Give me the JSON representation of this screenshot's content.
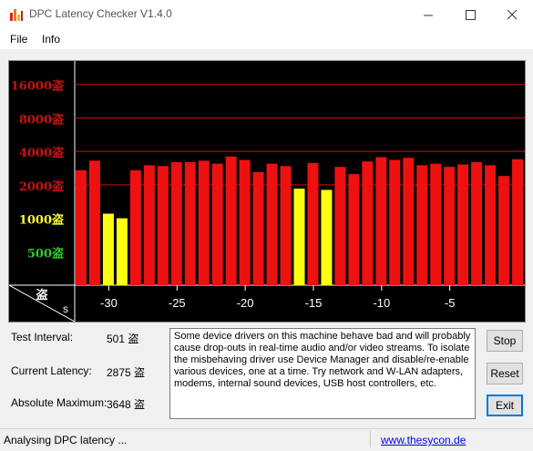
{
  "window": {
    "title": "DPC Latency Checker V1.4.0"
  },
  "menu": {
    "items": [
      "File",
      "Info"
    ]
  },
  "chart_data": {
    "type": "bar",
    "y_ticks": [
      {
        "label": "16000盗",
        "value": 16000,
        "color": "#cc1111"
      },
      {
        "label": "8000盗",
        "value": 8000,
        "color": "#cc1111"
      },
      {
        "label": "4000盗",
        "value": 4000,
        "color": "#cc1111"
      },
      {
        "label": "2000盗",
        "value": 2000,
        "color": "#cc1111"
      },
      {
        "label": "1000盗",
        "value": 1000,
        "color": "#ffff33"
      },
      {
        "label": "500盗",
        "value": 500,
        "color": "#33cc33"
      }
    ],
    "x_ticks": [
      -30,
      -25,
      -20,
      -15,
      -10,
      -5
    ],
    "x_tick_labels": [
      "-30",
      "-25",
      "-20",
      "-15",
      "-10",
      "-5"
    ],
    "corner_top": "盗",
    "corner_bottom": "s",
    "x_range": [
      -32,
      -1
    ],
    "bars": [
      {
        "x": -32,
        "value": 2700,
        "color": "red"
      },
      {
        "x": -31,
        "value": 3300,
        "color": "red"
      },
      {
        "x": -30,
        "value": 1100,
        "color": "yellow"
      },
      {
        "x": -29,
        "value": 1000,
        "color": "yellow"
      },
      {
        "x": -28,
        "value": 2700,
        "color": "red"
      },
      {
        "x": -27,
        "value": 3000,
        "color": "red"
      },
      {
        "x": -26,
        "value": 2950,
        "color": "red"
      },
      {
        "x": -25,
        "value": 3200,
        "color": "red"
      },
      {
        "x": -24,
        "value": 3200,
        "color": "red"
      },
      {
        "x": -23,
        "value": 3300,
        "color": "red"
      },
      {
        "x": -22,
        "value": 3100,
        "color": "red"
      },
      {
        "x": -21,
        "value": 3600,
        "color": "red"
      },
      {
        "x": -20,
        "value": 3350,
        "color": "red"
      },
      {
        "x": -19,
        "value": 2600,
        "color": "red"
      },
      {
        "x": -18,
        "value": 3100,
        "color": "red"
      },
      {
        "x": -17,
        "value": 2950,
        "color": "red"
      },
      {
        "x": -16,
        "value": 1850,
        "color": "yellow"
      },
      {
        "x": -15,
        "value": 3150,
        "color": "red"
      },
      {
        "x": -14,
        "value": 1800,
        "color": "yellow"
      },
      {
        "x": -13,
        "value": 2900,
        "color": "red"
      },
      {
        "x": -12,
        "value": 2500,
        "color": "red"
      },
      {
        "x": -11,
        "value": 3250,
        "color": "red"
      },
      {
        "x": -10,
        "value": 3550,
        "color": "red"
      },
      {
        "x": -9,
        "value": 3350,
        "color": "red"
      },
      {
        "x": -8,
        "value": 3500,
        "color": "red"
      },
      {
        "x": -7,
        "value": 3000,
        "color": "red"
      },
      {
        "x": -6,
        "value": 3100,
        "color": "red"
      },
      {
        "x": -5,
        "value": 2900,
        "color": "red"
      },
      {
        "x": -4,
        "value": 3050,
        "color": "red"
      },
      {
        "x": -3,
        "value": 3200,
        "color": "red"
      },
      {
        "x": -2,
        "value": 3000,
        "color": "red"
      },
      {
        "x": -1,
        "value": 2400,
        "color": "red"
      },
      {
        "x": 0,
        "value": 3400,
        "color": "red"
      }
    ]
  },
  "info": {
    "test_interval_label": "Test Interval:",
    "test_interval_value": "501 盗",
    "current_latency_label": "Current Latency:",
    "current_latency_value": "2875 盗",
    "absolute_maximum_label": "Absolute Maximum:",
    "absolute_maximum_value": "3648 盗"
  },
  "message": "Some device drivers on this machine behave bad and will probably cause drop-outs in real-time audio and/or video streams. To isolate the misbehaving driver use Device Manager and disable/re-enable various devices, one at a time. Try network and W-LAN adapters, modems, internal sound devices, USB host controllers, etc.",
  "buttons": {
    "stop": "Stop",
    "reset": "Reset",
    "exit": "Exit"
  },
  "status": {
    "text": "Analysing DPC latency ...",
    "link": "www.thesycon.de"
  },
  "colors": {
    "bar_red": "#ee1111",
    "bar_yellow": "#ffff11",
    "grid": "#cc1111"
  }
}
